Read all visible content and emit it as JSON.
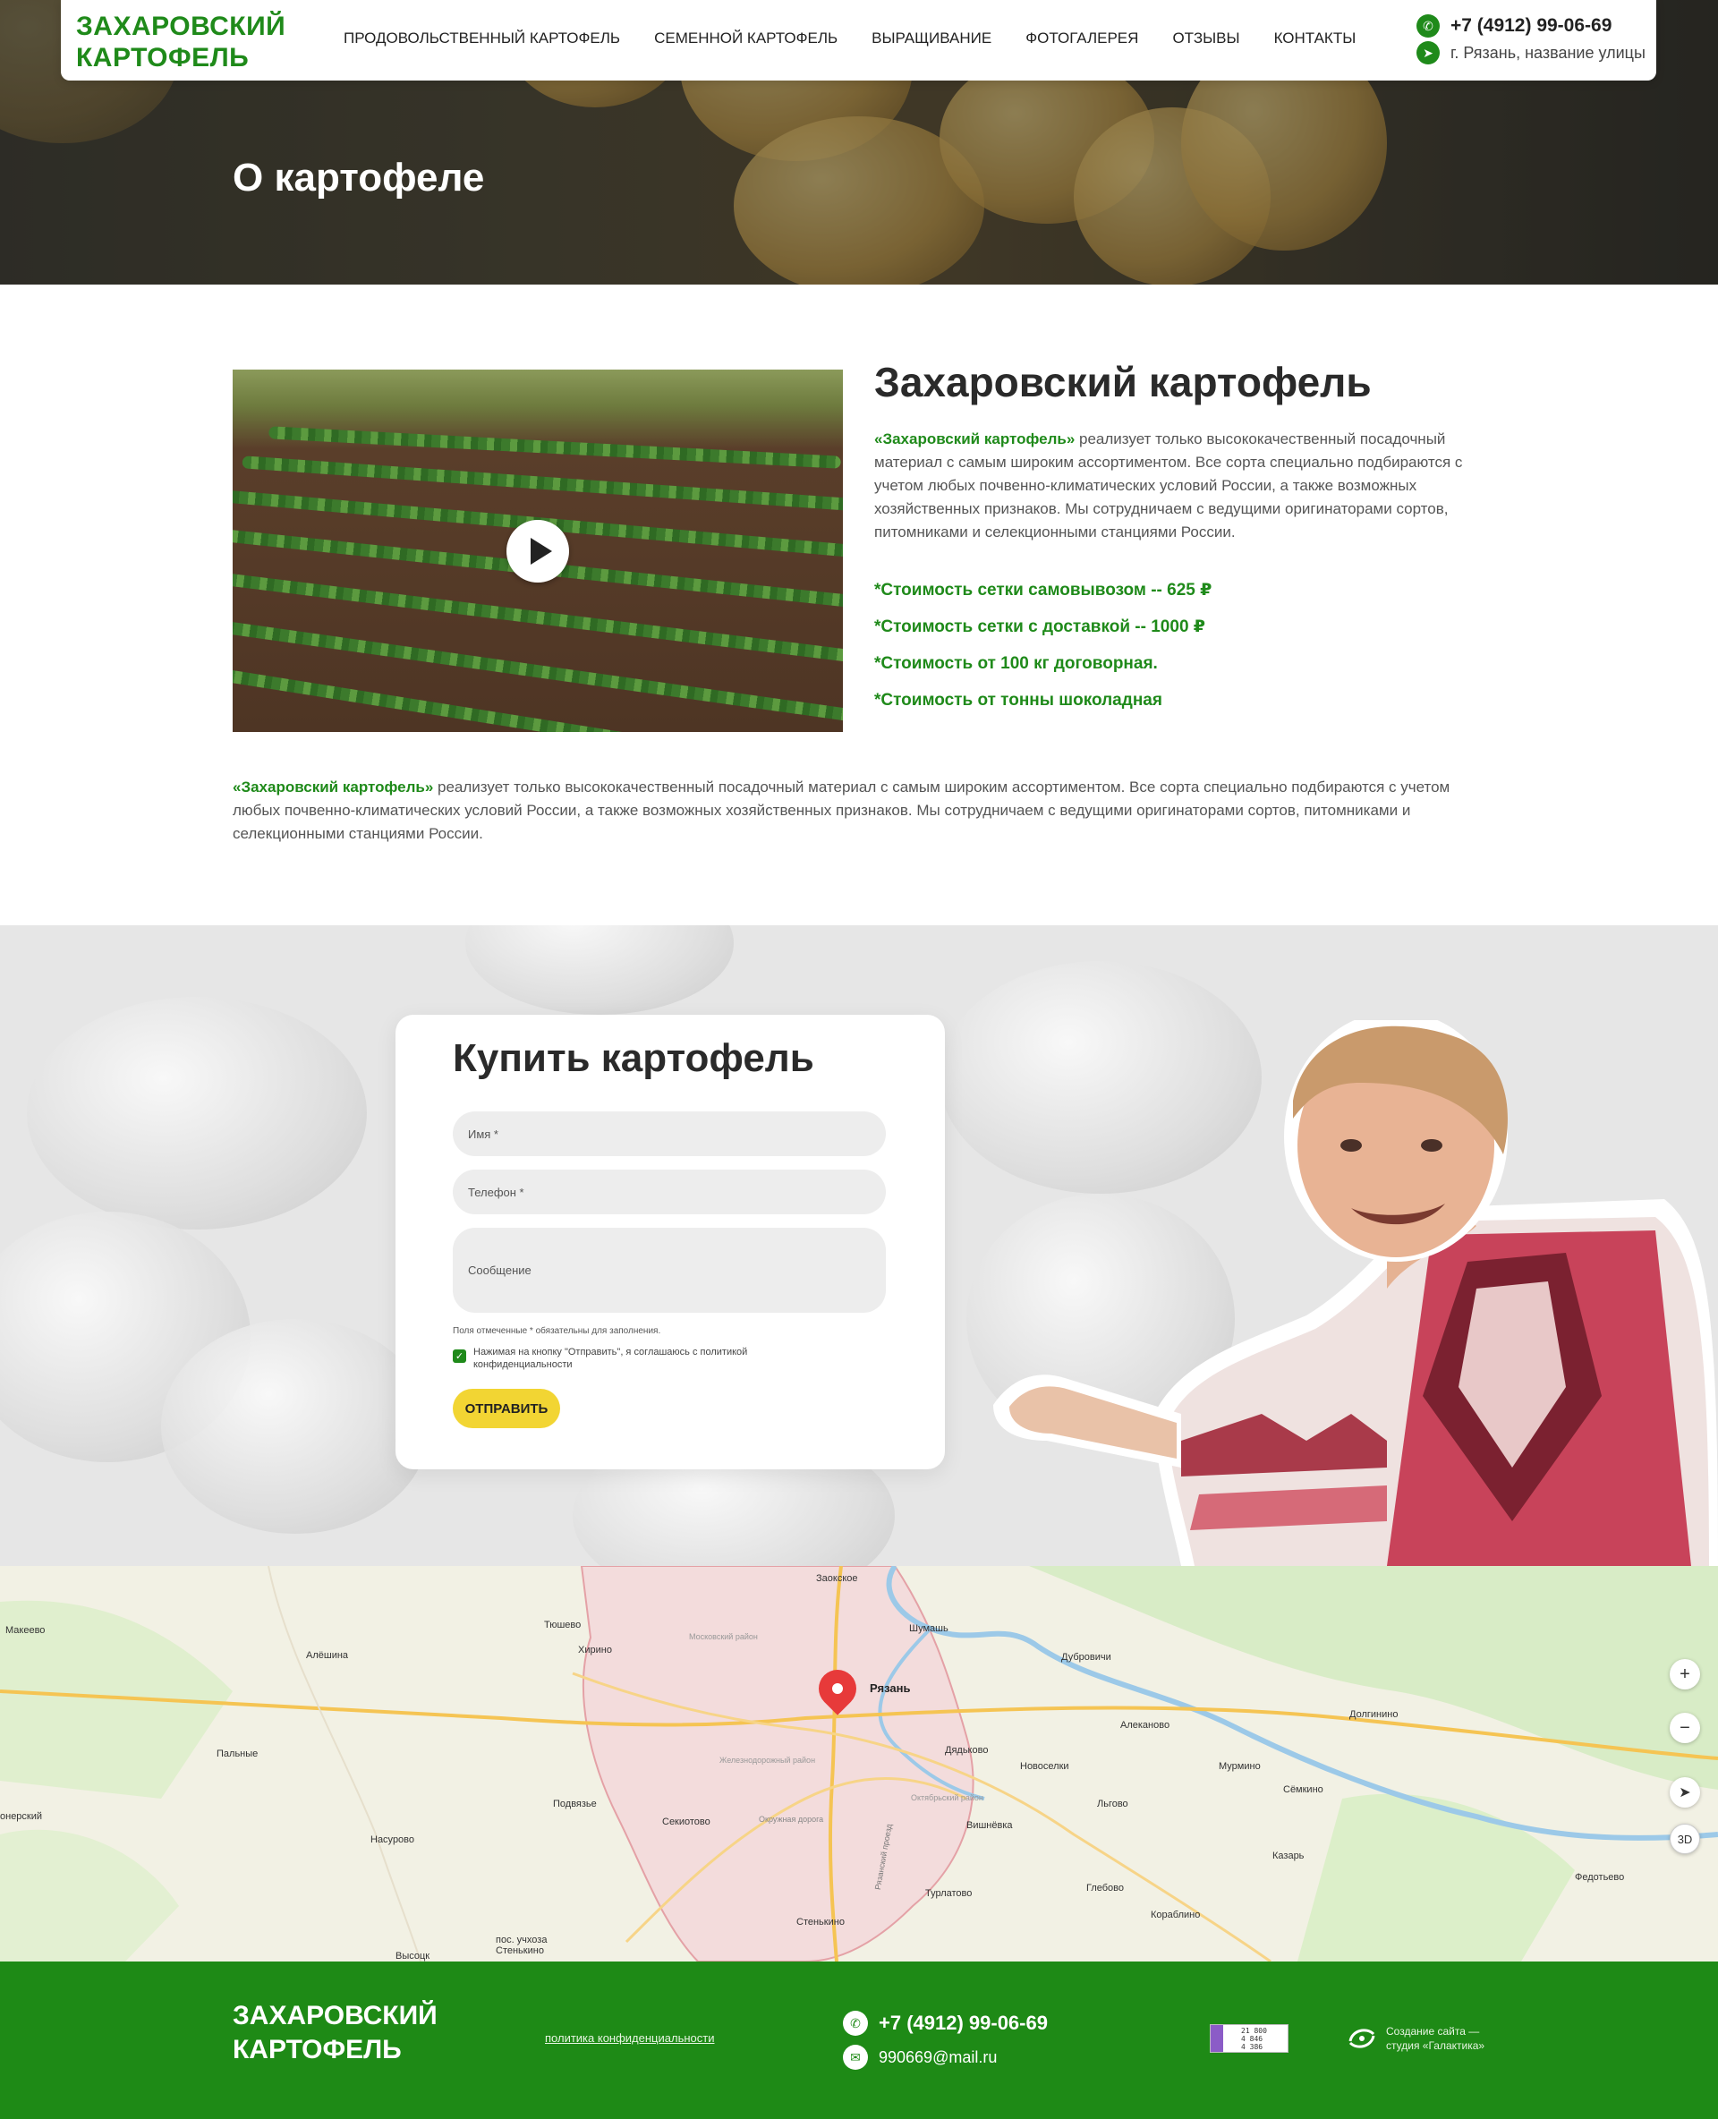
{
  "header": {
    "logo": "ЗАХАРОВСКИЙ КАРТОФЕЛЬ",
    "nav": [
      {
        "label": "ПРОДОВОЛЬСТВЕННЫЙ КАРТОФЕЛЬ"
      },
      {
        "label": "СЕМЕННОЙ КАРТОФЕЛЬ"
      },
      {
        "label": "ВЫРАЩИВАНИЕ"
      },
      {
        "label": "ФОТОГАЛЕРЕЯ"
      },
      {
        "label": "ОТЗЫВЫ"
      },
      {
        "label": "КОНТАКТЫ"
      }
    ],
    "phone": "+7 (4912) 99-06-69",
    "address": "г. Рязань, название улицы",
    "phone_icon": "phone-icon",
    "address_icon": "location-icon"
  },
  "hero": {
    "title": "О картофеле"
  },
  "about": {
    "title": "Захаровский картофель",
    "brand": "«Захаровский картофель»",
    "text": " реализует только высококачественный посадочный материал с самым широким ассортиментом. Все сорта специально подбираются с учетом любых почвенно-климатических условий России, а также возможных хозяйственных признаков. Мы сотрудничаем с ведущими оригинаторами сортов, питомниками и селекционными станциями России.",
    "prices": [
      "*Стоимость сетки  самовывозом -- 625 ₽",
      "*Стоимость сетки с доставкой -- 1000 ₽",
      "*Стоимость от 100 кг договорная.",
      "*Стоимость от тонны шоколадная"
    ],
    "full_brand": "«Захаровский картофель»",
    "full_text": " реализует только высококачественный посадочный материал с самым широким ассортиментом. Все сорта специально подбираются с учетом любых почвенно-климатических условий России, а также возможных хозяйственных признаков. Мы сотрудничаем с ведущими оригинаторами сортов, питомниками и селекционными станциями России.",
    "play_icon": "play-icon"
  },
  "buy": {
    "title": "Купить картофель",
    "name_placeholder": "Имя *",
    "phone_placeholder": "Телефон *",
    "message_placeholder": "Сообщение",
    "required_note": "Поля отмеченные * обязательны для заполнения.",
    "agree_text": "Нажимая на кнопку \"Отправить\", я соглашаюсь с политикой конфиденциальности",
    "agree_checked": true,
    "submit_label": "ОТПРАВИТЬ",
    "accent": "#f2d533"
  },
  "map": {
    "city_label": "Рязань",
    "labels": [
      "Макеево",
      "Алёшина",
      "Тюшево",
      "Хирино",
      "Заокское",
      "Шумашь",
      "Дубровичи",
      "Московский район",
      "Железнодорожный район",
      "Октябрьский район",
      "Окружная дорога",
      "Пальные",
      "Подвязье",
      "Насурово",
      "Секиотово",
      "Дядьково",
      "Новоселки",
      "Алеканово",
      "Мурмино",
      "Сёмкино",
      "Долгинино",
      "Вишнёвка",
      "Льгово",
      "Глебово",
      "Турлатово",
      "Кораблино",
      "Казарь",
      "Федотьево",
      "Стенькино",
      "пос. учхоза Стенькино",
      "Высоцк",
      "онерский",
      "Рязанский проезд"
    ],
    "controls": {
      "zoom_in": "+",
      "zoom_out": "−",
      "locate_icon": "locate-icon",
      "view_3d": "3D"
    }
  },
  "footer": {
    "logo": "ЗАХАРОВСКИЙ КАРТОФЕЛЬ",
    "policy": "политика конфиденциальности",
    "phone": "+7 (4912) 99-06-69",
    "email": "990669@mail.ru",
    "counter_lines": [
      "21 800",
      "4 846",
      "4 386"
    ],
    "studio": "Создание сайта — студия «Галактика»",
    "colors": {
      "green": "#1e8a16"
    }
  }
}
